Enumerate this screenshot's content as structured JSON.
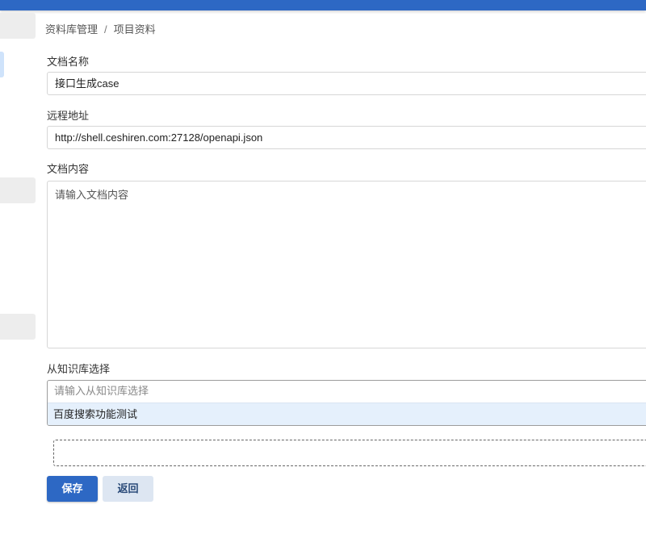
{
  "breadcrumb": {
    "root": "资料库管理",
    "separator": "/",
    "current": "项目资料"
  },
  "form": {
    "doc_name": {
      "label": "文档名称",
      "value": "接口生成case"
    },
    "remote_url": {
      "label": "远程地址",
      "value": "http://shell.ceshiren.com:27128/openapi.json"
    },
    "doc_content": {
      "label": "文档内容",
      "placeholder": "请输入文档内容"
    },
    "knowledge_base": {
      "label": "从知识库选择",
      "placeholder": "请输入从知识库选择",
      "options": [
        "百度搜索功能测试"
      ]
    }
  },
  "buttons": {
    "save": "保存",
    "back": "返回"
  },
  "colors": {
    "primary": "#2d68c4",
    "option_highlight": "#e5f0fc",
    "secondary_button": "#dde6f2"
  }
}
